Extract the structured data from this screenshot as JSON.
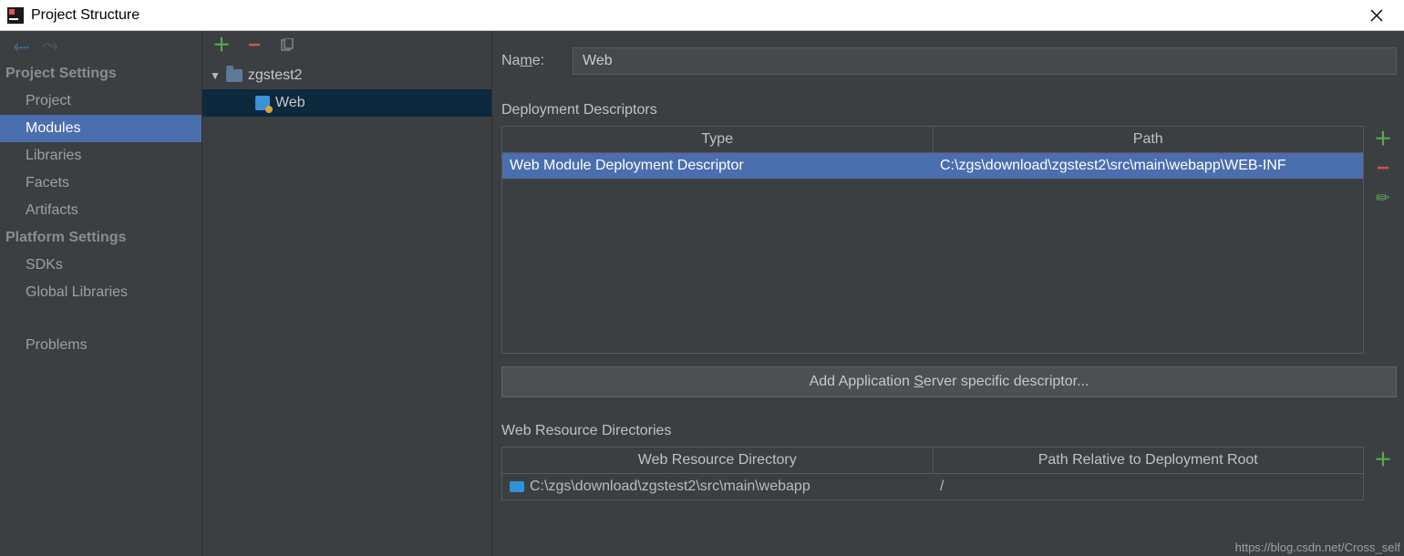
{
  "window": {
    "title": "Project Structure"
  },
  "leftNav": {
    "groups": [
      {
        "title": "Project Settings",
        "items": [
          "Project",
          "Modules",
          "Libraries",
          "Facets",
          "Artifacts"
        ],
        "selectedIndex": 1
      },
      {
        "title": "Platform Settings",
        "items": [
          "SDKs",
          "Global Libraries"
        ]
      }
    ],
    "footerItem": "Problems"
  },
  "tree": {
    "root": {
      "label": "zgstest2"
    },
    "child": {
      "label": "Web"
    }
  },
  "form": {
    "nameLabelPrefix": "Na",
    "nameLabelU": "m",
    "nameLabelSuffix": "e:",
    "nameValue": "Web"
  },
  "deployment": {
    "sectionTitle": "Deployment Descriptors",
    "headers": [
      "Type",
      "Path"
    ],
    "rows": [
      {
        "type": "Web Module Deployment Descriptor",
        "path": "C:\\zgs\\download\\zgstest2\\src\\main\\webapp\\WEB-INF"
      }
    ],
    "addButtonPrefix": "Add Application ",
    "addButtonU": "S",
    "addButtonSuffix": "erver specific descriptor..."
  },
  "webres": {
    "sectionTitle": "Web Resource Directories",
    "headers": [
      "Web Resource Directory",
      "Path Relative to Deployment Root"
    ],
    "rows": [
      {
        "dir": "C:\\zgs\\download\\zgstest2\\src\\main\\webapp",
        "path": "/"
      }
    ]
  },
  "watermark": "https://blog.csdn.net/Cross_self"
}
